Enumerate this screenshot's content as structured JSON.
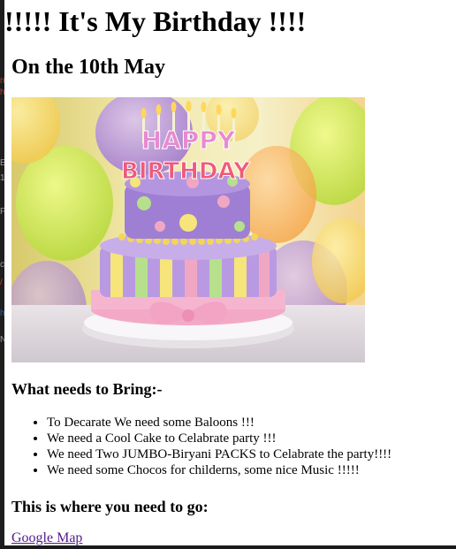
{
  "page": {
    "title": "!!!!! It's My Birthday !!!!",
    "subtitle": "On the 10th May",
    "image_alt": "Birthday cake",
    "cake_text": {
      "happy": "HAPPY",
      "birthday": "BIRTHDAY"
    }
  },
  "bring": {
    "heading": "What needs to Bring:-",
    "items": [
      "To Decarate We need some Baloons !!!",
      "We need a Cool Cake to Celabrate party !!!",
      "We need Two JUMBO-Biryani PACKS to Celabrate the party!!!!",
      "We need some Chocos for childerns, some nice Music !!!!!"
    ]
  },
  "directions": {
    "heading": "This is where you need to go:",
    "link_text": "Google Map"
  },
  "colors": {
    "link_visited": "#551a8b",
    "background_frame": "#2b2b2b"
  }
}
